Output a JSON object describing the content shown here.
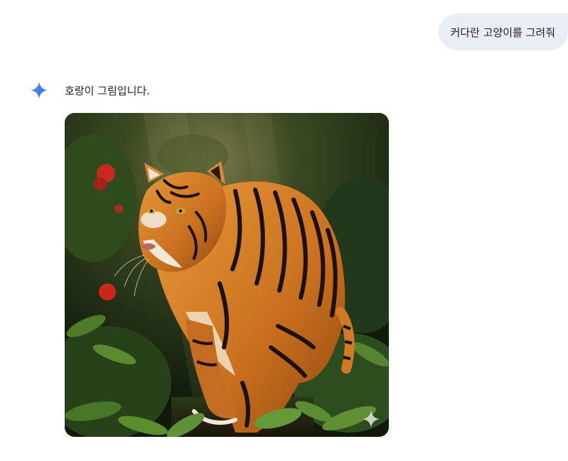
{
  "user_message": {
    "text": "커다란 고양이를 그려줘"
  },
  "response": {
    "icon": "gemini-spark-icon",
    "text": "호랑이 그림입니다.",
    "image": {
      "subject": "tiger-image",
      "watermark_icon": "spark-watermark-icon"
    }
  },
  "colors": {
    "bubble_bg": "#e9eef6",
    "spark_blue": "#4f8ef7",
    "text": "#1f1f1f"
  }
}
